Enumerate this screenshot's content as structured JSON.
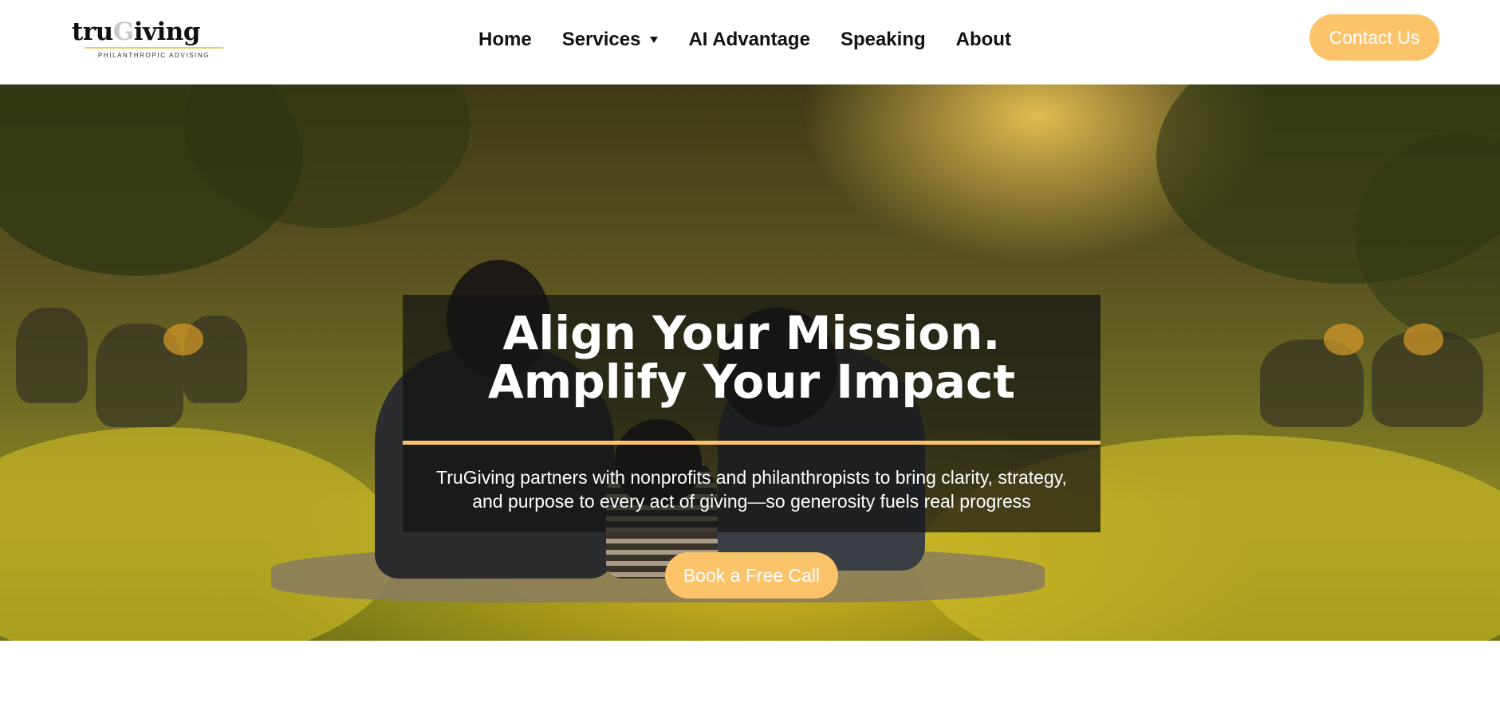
{
  "brand": {
    "logo_text_before": "tru",
    "logo_text_g": "G",
    "logo_text_after": "iving",
    "tagline": "PHILANTHROPIC ADVISING"
  },
  "nav": {
    "items": [
      {
        "label": "Home"
      },
      {
        "label": "Services",
        "has_dropdown": true
      },
      {
        "label": "AI Advantage"
      },
      {
        "label": "Speaking"
      },
      {
        "label": "About"
      }
    ]
  },
  "header": {
    "contact_label": "Contact Us"
  },
  "hero": {
    "title_line1": "Align Your Mission.",
    "title_line2": "Amplify Your Impact",
    "subtitle_line1": "TruGiving partners with nonprofits and philanthropists to bring clarity, strategy,",
    "subtitle_line2": "and purpose to every act of giving—so generosity fuels real progress",
    "cta_label": "Book a Free Call"
  },
  "colors": {
    "accent": "#fcc46a",
    "text": "#111111",
    "overlay": "#141414"
  }
}
